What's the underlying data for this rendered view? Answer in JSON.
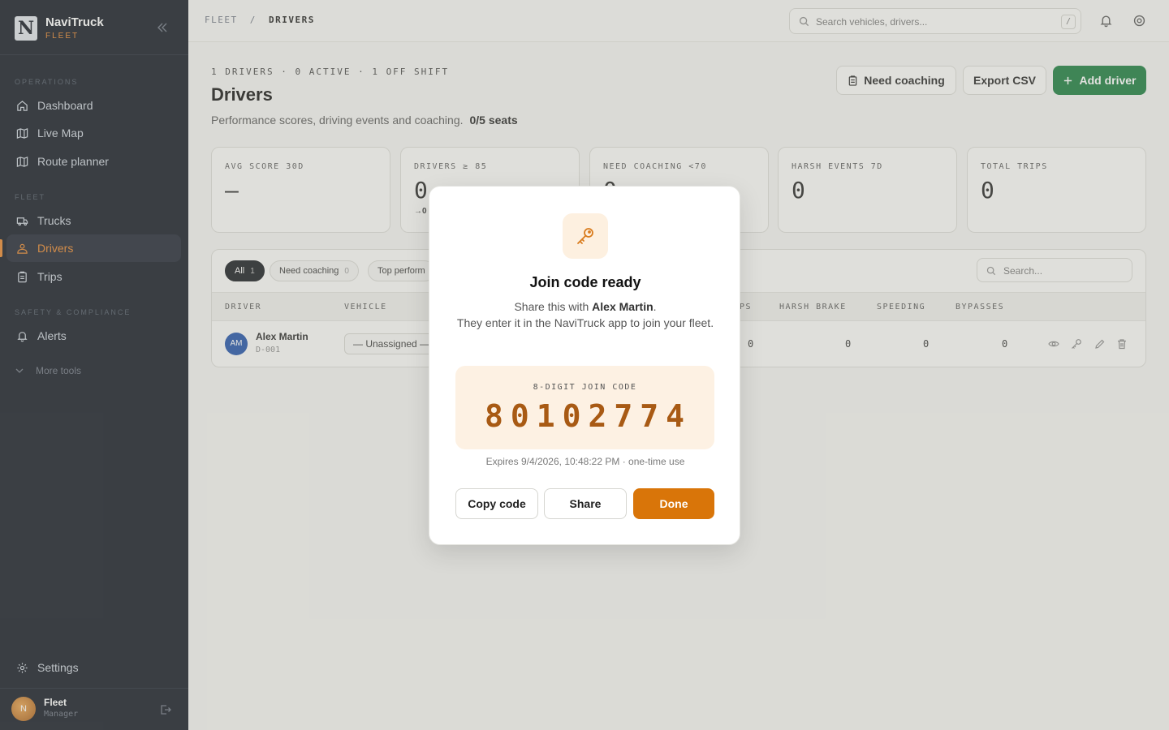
{
  "sidebar": {
    "brand_letter": "N",
    "brand_name": "NaviTruck",
    "brand_sub": "FLEET",
    "sections": {
      "operations": "OPERATIONS",
      "fleet": "FLEET",
      "safety": "SAFETY & COMPLIANCE"
    },
    "items": {
      "dashboard": "Dashboard",
      "live_map": "Live Map",
      "route_planner": "Route planner",
      "trucks": "Trucks",
      "drivers": "Drivers",
      "trips": "Trips",
      "alerts": "Alerts"
    },
    "more_tools": "More tools",
    "settings": "Settings",
    "user": {
      "initial": "N",
      "name": "Fleet",
      "role": "Manager"
    }
  },
  "topbar": {
    "crumb_root": "FLEET",
    "crumb_sep": "/",
    "crumb_current": "DRIVERS",
    "search_placeholder": "Search vehicles, drivers...",
    "search_shortcut": "/"
  },
  "header": {
    "meta": "1 DRIVERS · 0 ACTIVE · 1 OFF SHIFT",
    "title": "Drivers",
    "description": "Performance scores, driving events and coaching.",
    "seats": "0/5 seats",
    "buttons": {
      "need_coaching": "Need coaching",
      "export_csv": "Export CSV",
      "add_driver": "Add driver"
    }
  },
  "stats": [
    {
      "label": "AVG SCORE 30D",
      "value": "—"
    },
    {
      "label": "DRIVERS ≥ 85",
      "value": "0",
      "sub": "→0"
    },
    {
      "label": "NEED COACHING <70",
      "value": "0"
    },
    {
      "label": "HARSH EVENTS 7D",
      "value": "0"
    },
    {
      "label": "TOTAL TRIPS",
      "value": "0"
    }
  ],
  "filters": [
    {
      "label": "All",
      "count": "1"
    },
    {
      "label": "Need coaching",
      "count": "0"
    },
    {
      "label": "Top perform",
      "count": ""
    }
  ],
  "table": {
    "search_placeholder": "Search...",
    "columns": {
      "driver": "DRIVER",
      "vehicle": "VEHICLE",
      "trips_partial": "PS",
      "harsh_brake": "HARSH BRAKE",
      "speeding": "SPEEDING",
      "bypasses": "BYPASSES"
    },
    "rows": [
      {
        "initials": "AM",
        "name": "Alex Martin",
        "id": "D-001",
        "vehicle": "— Unassigned —",
        "trips": "0",
        "harsh_brake": "0",
        "speeding": "0",
        "bypasses": "0"
      }
    ]
  },
  "modal": {
    "title": "Join code ready",
    "line1_prefix": "Share this with ",
    "driver_name": "Alex Martin",
    "line1_suffix": ".",
    "line2": "They enter it in the NaviTruck app to join your fleet.",
    "code_label": "8-DIGIT JOIN CODE",
    "code": "80102774",
    "expires": "Expires 9/4/2026, 10:48:22 PM · one-time use",
    "buttons": {
      "copy": "Copy code",
      "share": "Share",
      "done": "Done"
    }
  },
  "colors": {
    "accent": "#e9852a",
    "primary_green": "#167a3c",
    "done_orange": "#d97509",
    "sidebar_bg": "#0f1520"
  }
}
